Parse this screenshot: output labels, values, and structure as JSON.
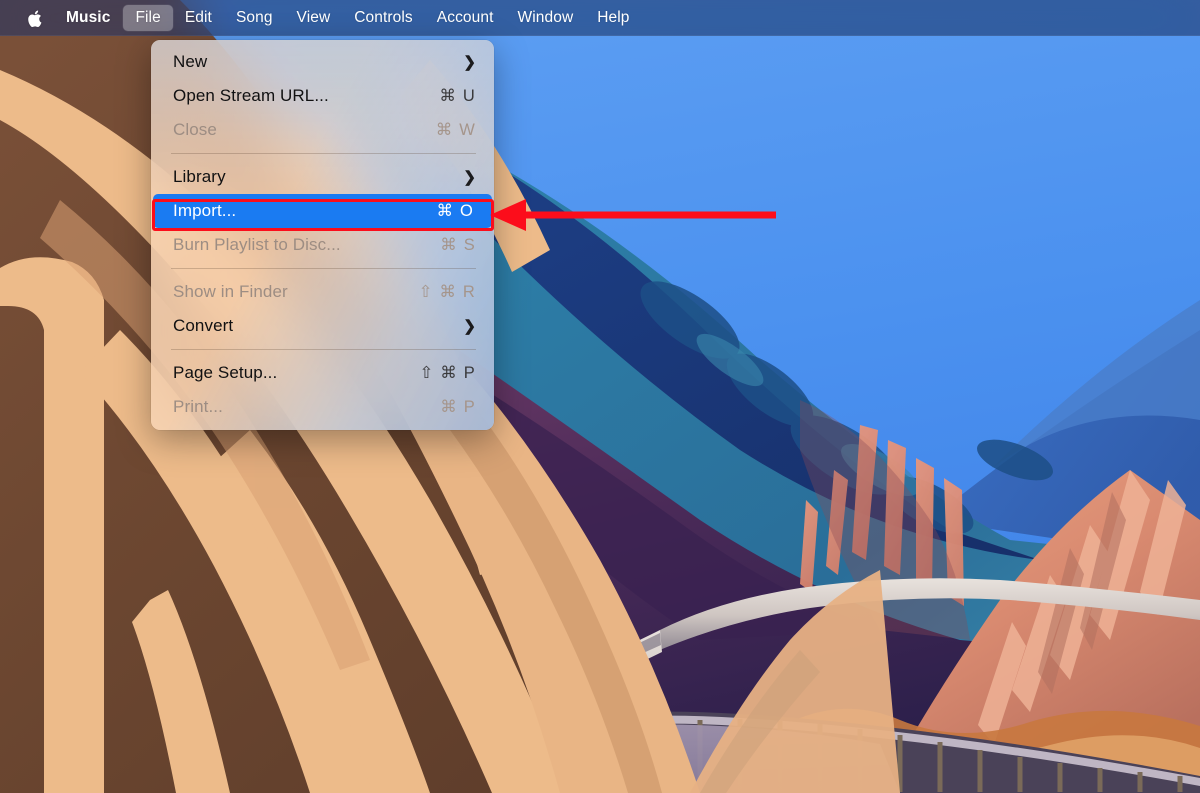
{
  "menubar": {
    "apple_icon": "apple-logo-icon",
    "items": [
      {
        "label": "Music",
        "bold": true,
        "active": false
      },
      {
        "label": "File",
        "bold": false,
        "active": true
      },
      {
        "label": "Edit",
        "bold": false,
        "active": false
      },
      {
        "label": "Song",
        "bold": false,
        "active": false
      },
      {
        "label": "View",
        "bold": false,
        "active": false
      },
      {
        "label": "Controls",
        "bold": false,
        "active": false
      },
      {
        "label": "Account",
        "bold": false,
        "active": false
      },
      {
        "label": "Window",
        "bold": false,
        "active": false
      },
      {
        "label": "Help",
        "bold": false,
        "active": false
      }
    ]
  },
  "file_menu": {
    "title": "File",
    "rows": [
      {
        "type": "item",
        "label": "New",
        "shortcut": "",
        "submenu": true,
        "disabled": false,
        "selected": false
      },
      {
        "type": "item",
        "label": "Open Stream URL...",
        "shortcut": "⌘ U",
        "submenu": false,
        "disabled": false,
        "selected": false
      },
      {
        "type": "item",
        "label": "Close",
        "shortcut": "⌘ W",
        "submenu": false,
        "disabled": true,
        "selected": false
      },
      {
        "type": "separator"
      },
      {
        "type": "item",
        "label": "Library",
        "shortcut": "",
        "submenu": true,
        "disabled": false,
        "selected": false
      },
      {
        "type": "item",
        "label": "Import...",
        "shortcut": "⌘ O",
        "submenu": false,
        "disabled": false,
        "selected": true
      },
      {
        "type": "item",
        "label": "Burn Playlist to Disc...",
        "shortcut": "⌘ S",
        "submenu": false,
        "disabled": true,
        "selected": false
      },
      {
        "type": "separator"
      },
      {
        "type": "item",
        "label": "Show in Finder",
        "shortcut": "⇧ ⌘ R",
        "submenu": false,
        "disabled": true,
        "selected": false
      },
      {
        "type": "item",
        "label": "Convert",
        "shortcut": "",
        "submenu": true,
        "disabled": false,
        "selected": false
      },
      {
        "type": "separator"
      },
      {
        "type": "item",
        "label": "Page Setup...",
        "shortcut": "⇧ ⌘ P",
        "submenu": false,
        "disabled": false,
        "selected": false
      },
      {
        "type": "item",
        "label": "Print...",
        "shortcut": "⌘ P",
        "submenu": false,
        "disabled": true,
        "selected": false
      }
    ]
  },
  "annotation": {
    "highlight_color": "#fc0d1b",
    "arrow_direction": "left",
    "target_label": "Import..."
  },
  "colors": {
    "menubar_bg": "#223668",
    "menu_bg": "#f7d8bb",
    "selection_blue": "#1a7bf2",
    "sky_blue": "#4c93f0",
    "cliff_tan": "#edbb8a",
    "cliff_brown": "#6b4630"
  },
  "wallpaper": {
    "name": "macos-monterey-desert-canyon"
  }
}
